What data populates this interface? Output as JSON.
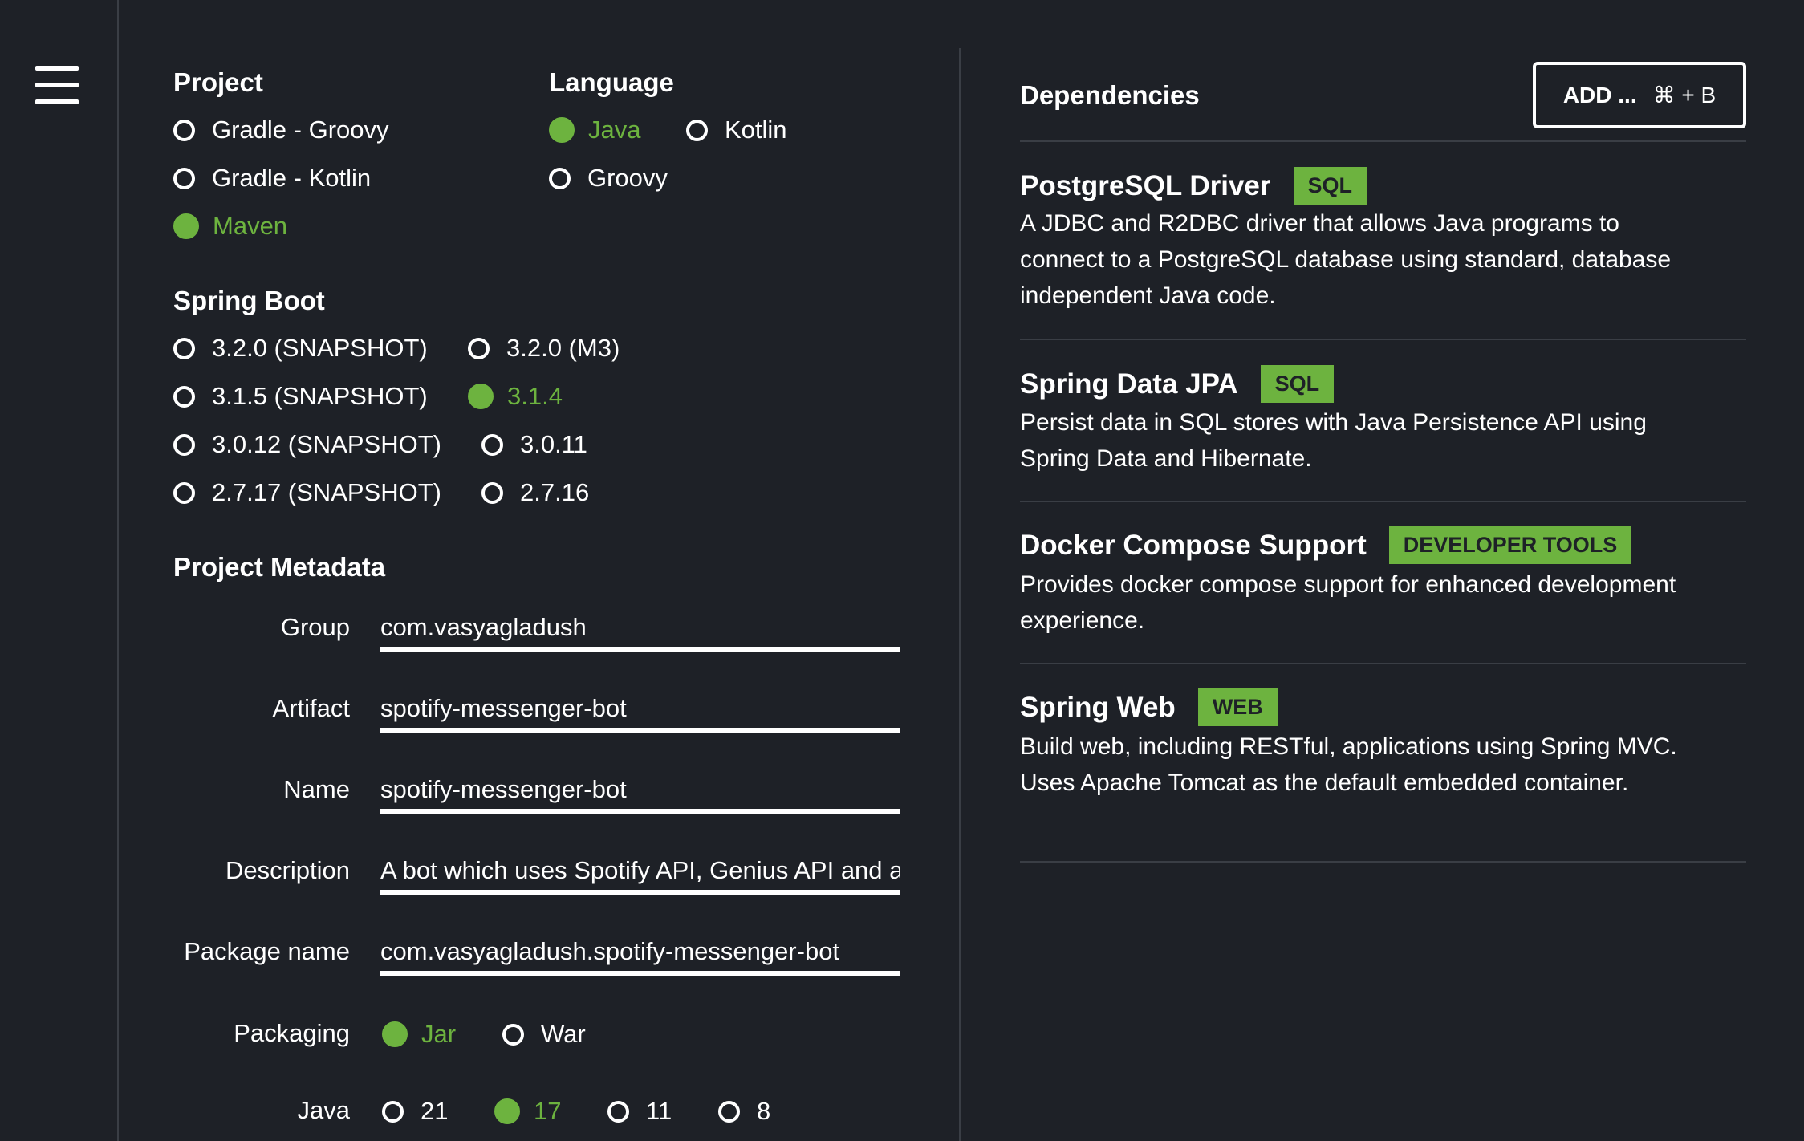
{
  "project": {
    "title": "Project",
    "options": [
      "Gradle - Groovy",
      "Gradle - Kotlin",
      "Maven"
    ],
    "selected": "Maven"
  },
  "language": {
    "title": "Language",
    "options": [
      "Java",
      "Kotlin",
      "Groovy"
    ],
    "selected": "Java"
  },
  "spring_boot": {
    "title": "Spring Boot",
    "options": [
      "3.2.0 (SNAPSHOT)",
      "3.2.0 (M3)",
      "3.1.5 (SNAPSHOT)",
      "3.1.4",
      "3.0.12 (SNAPSHOT)",
      "3.0.11",
      "2.7.17 (SNAPSHOT)",
      "2.7.16"
    ],
    "selected": "3.1.4"
  },
  "metadata": {
    "title": "Project Metadata",
    "group": {
      "label": "Group",
      "value": "com.vasyagladush"
    },
    "artifact": {
      "label": "Artifact",
      "value": "spotify-messenger-bot"
    },
    "name": {
      "label": "Name",
      "value": "spotify-messenger-bot"
    },
    "description": {
      "label": "Description",
      "value": "A bot which uses Spotify API, Genius API and a r"
    },
    "package_name": {
      "label": "Package name",
      "value": "com.vasyagladush.spotify-messenger-bot"
    },
    "packaging": {
      "label": "Packaging",
      "options": [
        "Jar",
        "War"
      ],
      "selected": "Jar"
    },
    "java": {
      "label": "Java",
      "options": [
        "21",
        "17",
        "11",
        "8"
      ],
      "selected": "17"
    }
  },
  "dependencies": {
    "title": "Dependencies",
    "add_label": "ADD ...",
    "add_shortcut": "⌘ + B",
    "items": [
      {
        "name": "PostgreSQL Driver",
        "badge": "SQL",
        "description": "A JDBC and R2DBC driver that allows Java programs to connect to a PostgreSQL database using standard, database independent Java code."
      },
      {
        "name": "Spring Data JPA",
        "badge": "SQL",
        "description": "Persist data in SQL stores with Java Persistence API using Spring Data and Hibernate."
      },
      {
        "name": "Docker Compose Support",
        "badge": "DEVELOPER TOOLS",
        "description": "Provides docker compose support for enhanced development experience."
      },
      {
        "name": "Spring Web",
        "badge": "WEB",
        "description": "Build web, including RESTful, applications using Spring MVC. Uses Apache Tomcat as the default embedded container."
      }
    ]
  },
  "colors": {
    "accent": "#6db33f",
    "background": "#1e2127",
    "divider": "#3a3e45"
  },
  "icons": {
    "menu": "hamburger-menu-icon",
    "radio": "radio-icon"
  }
}
